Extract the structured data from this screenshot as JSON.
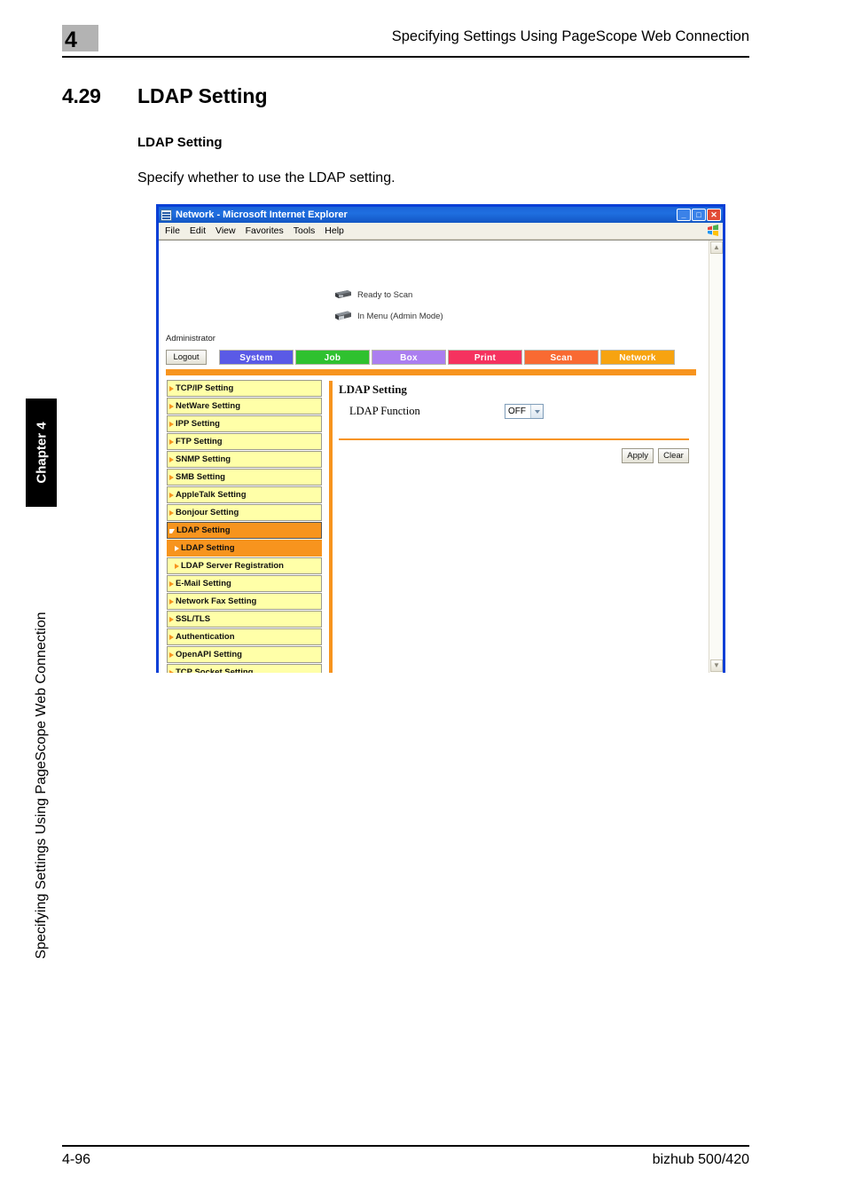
{
  "page": {
    "chapter_number": "4",
    "header_title": "Specifying Settings Using PageScope Web Connection",
    "section_number": "4.29",
    "section_title": "LDAP Setting",
    "subheading": "LDAP Setting",
    "body_text": "Specify whether to use the LDAP setting.",
    "side_chapter_tab": "Chapter 4",
    "side_running_title": "Specifying Settings Using PageScope Web Connection",
    "footer_left": "4-96",
    "footer_right": "bizhub 500/420"
  },
  "browser": {
    "title": "Network - Microsoft Internet Explorer",
    "window_buttons": {
      "minimize": "_",
      "maximize": "□",
      "close": "✕"
    },
    "menu": [
      "File",
      "Edit",
      "View",
      "Favorites",
      "Tools",
      "Help"
    ]
  },
  "webpage": {
    "status": [
      {
        "icon": "printer-icon",
        "label": "Ready to Scan"
      },
      {
        "icon": "printer-icon",
        "label": "In Menu (Admin Mode)"
      }
    ],
    "user_label": "Administrator",
    "logout_label": "Logout",
    "tabs": [
      {
        "label": "System",
        "color": "#5a5ae6"
      },
      {
        "label": "Job",
        "color": "#2fc12f"
      },
      {
        "label": "Box",
        "color": "#ab7ef0"
      },
      {
        "label": "Print",
        "color": "#f5325f"
      },
      {
        "label": "Scan",
        "color": "#f96a32"
      },
      {
        "label": "Network",
        "color": "#f7a310"
      }
    ],
    "active_tab": "Network",
    "accent_color": "#f7941e",
    "sidebar": [
      {
        "label": "TCP/IP Setting",
        "state": "normal",
        "marker": "right"
      },
      {
        "label": "NetWare Setting",
        "state": "normal",
        "marker": "right"
      },
      {
        "label": "IPP Setting",
        "state": "normal",
        "marker": "right"
      },
      {
        "label": "FTP Setting",
        "state": "normal",
        "marker": "right"
      },
      {
        "label": "SNMP Setting",
        "state": "normal",
        "marker": "right"
      },
      {
        "label": "SMB Setting",
        "state": "normal",
        "marker": "right"
      },
      {
        "label": "AppleTalk Setting",
        "state": "normal",
        "marker": "right"
      },
      {
        "label": "Bonjour Setting",
        "state": "normal",
        "marker": "right"
      },
      {
        "label": "LDAP Setting",
        "state": "expanded",
        "marker": "down"
      },
      {
        "label": "LDAP Setting",
        "state": "selected",
        "marker": "right"
      },
      {
        "label": "LDAP Server Registration",
        "state": "child",
        "marker": "right"
      },
      {
        "label": "E-Mail Setting",
        "state": "normal",
        "marker": "right"
      },
      {
        "label": "Network Fax Setting",
        "state": "normal",
        "marker": "right"
      },
      {
        "label": "SSL/TLS",
        "state": "normal",
        "marker": "right"
      },
      {
        "label": "Authentication",
        "state": "normal",
        "marker": "right"
      },
      {
        "label": "OpenAPI Setting",
        "state": "normal",
        "marker": "right"
      },
      {
        "label": "TCP Socket Setting",
        "state": "normal",
        "marker": "right"
      }
    ],
    "panel": {
      "title": "LDAP Setting",
      "field_label": "LDAP Function",
      "field_value": "OFF",
      "apply_label": "Apply",
      "clear_label": "Clear"
    }
  }
}
